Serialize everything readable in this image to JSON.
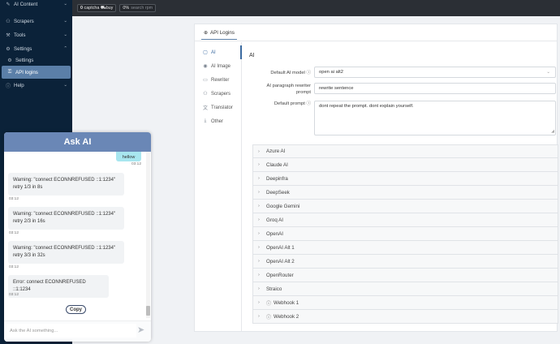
{
  "sidebar": {
    "items": [
      {
        "label": "AI Content",
        "icon": "ai-content-icon",
        "glyph": "✎",
        "chevron": "⌄"
      },
      {
        "label": "Scrapers",
        "icon": "scraper-icon",
        "glyph": "⚇",
        "chevron": "⌄"
      },
      {
        "label": "Tools",
        "icon": "tools-icon",
        "glyph": "⚒",
        "chevron": "⌄"
      },
      {
        "label": "Settings",
        "icon": "gear-icon",
        "glyph": "⚙",
        "chevron": "⌃"
      },
      {
        "label": "Settings",
        "icon": "gear-icon",
        "glyph": "⚙"
      },
      {
        "label": "API logins",
        "icon": "key-icon",
        "glyph": "⚿"
      },
      {
        "label": "Help",
        "icon": "help-icon",
        "glyph": "ⓘ",
        "chevron": "⌄"
      }
    ]
  },
  "topbar": {
    "captcha_count": "0",
    "captcha_label": "captcha",
    "buy_label": "buy",
    "search_percent": "0%",
    "search_label": "search rpm"
  },
  "card": {
    "tab_label": "API Logins",
    "subnav": [
      {
        "label": "AI",
        "icon": "ai-icon",
        "glyph": "▢"
      },
      {
        "label": "AI Image",
        "icon": "image-icon",
        "glyph": "◉"
      },
      {
        "label": "Rewriter",
        "icon": "rewriter-icon",
        "glyph": "▭"
      },
      {
        "label": "Scrapers",
        "icon": "scraper-icon",
        "glyph": "⚇"
      },
      {
        "label": "Translator",
        "icon": "translator-icon",
        "glyph": "文"
      },
      {
        "label": "Other",
        "icon": "other-icon",
        "glyph": "⤓"
      }
    ],
    "section_title": "AI",
    "fields": {
      "default_model_label": "Default AI model",
      "default_model_value": "open ai alt2",
      "rewriter_prompt_label_1": "AI paragraph rewriter",
      "rewriter_prompt_label_2": "prompt",
      "rewriter_prompt_value": "rewrite sentence",
      "default_prompt_label": "Default prompt",
      "default_prompt_value": "dont repeat the prompt. dont explain yourself."
    },
    "accordion": [
      {
        "label": "Azure AI"
      },
      {
        "label": "Claude AI"
      },
      {
        "label": "Deepinfra"
      },
      {
        "label": "DeepSeek"
      },
      {
        "label": "Google Gemini"
      },
      {
        "label": "Groq AI"
      },
      {
        "label": "OpenAI"
      },
      {
        "label": "OpenAI Alt 1"
      },
      {
        "label": "OpenAI Alt 2"
      },
      {
        "label": "OpenRouter"
      },
      {
        "label": "Straico"
      },
      {
        "label": "Webhook 1",
        "warn": true
      },
      {
        "label": "Webhook 2",
        "warn": true
      }
    ]
  },
  "askai": {
    "title": "Ask AI",
    "user_msg": "hellow",
    "user_time": "03:12",
    "messages": [
      {
        "line1": "Warning: \"connect ECONNREFUSED ::1:1234\"",
        "line2": "retry 1/3 in 8s",
        "time": "03:12"
      },
      {
        "line1": "Warning: \"connect ECONNREFUSED ::1:1234\"",
        "line2": "retry 2/3 in 16s",
        "time": "03:12"
      },
      {
        "line1": "Warning: \"connect ECONNREFUSED ::1:1234\"",
        "line2": "retry 3/3 in 32s",
        "time": "03:12"
      },
      {
        "line1": "Error: connect ECONNREFUSED ::1:1234",
        "line2": "",
        "time": "03:12"
      }
    ],
    "copy_label": "Copy",
    "input_placeholder": "Ask the AI something..."
  }
}
